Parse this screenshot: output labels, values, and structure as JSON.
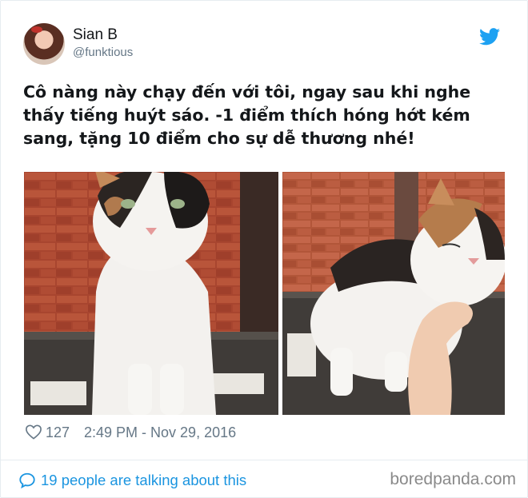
{
  "author": {
    "name": "Sian B",
    "handle": "@funktious"
  },
  "tweet": {
    "text": "Cô nàng này chạy đến với tôi, ngay sau khi nghe thấy tiếng huýt sáo. -1 điểm thích hóng hớt kém sang, tặng 10 điểm cho sự dễ thương nhé!"
  },
  "stats": {
    "likes": "127",
    "timestamp": "2:49 PM - Nov 29, 2016"
  },
  "footer": {
    "talking": "19 people are talking about this",
    "watermark": "boredpanda.com"
  },
  "icons": {
    "brand": "twitter-bird-icon",
    "like": "heart-icon",
    "reply": "speech-bubble-icon"
  },
  "colors": {
    "link": "#1b95e0",
    "twitter_blue": "#1da1f2",
    "muted": "#657786",
    "text": "#14171a"
  }
}
